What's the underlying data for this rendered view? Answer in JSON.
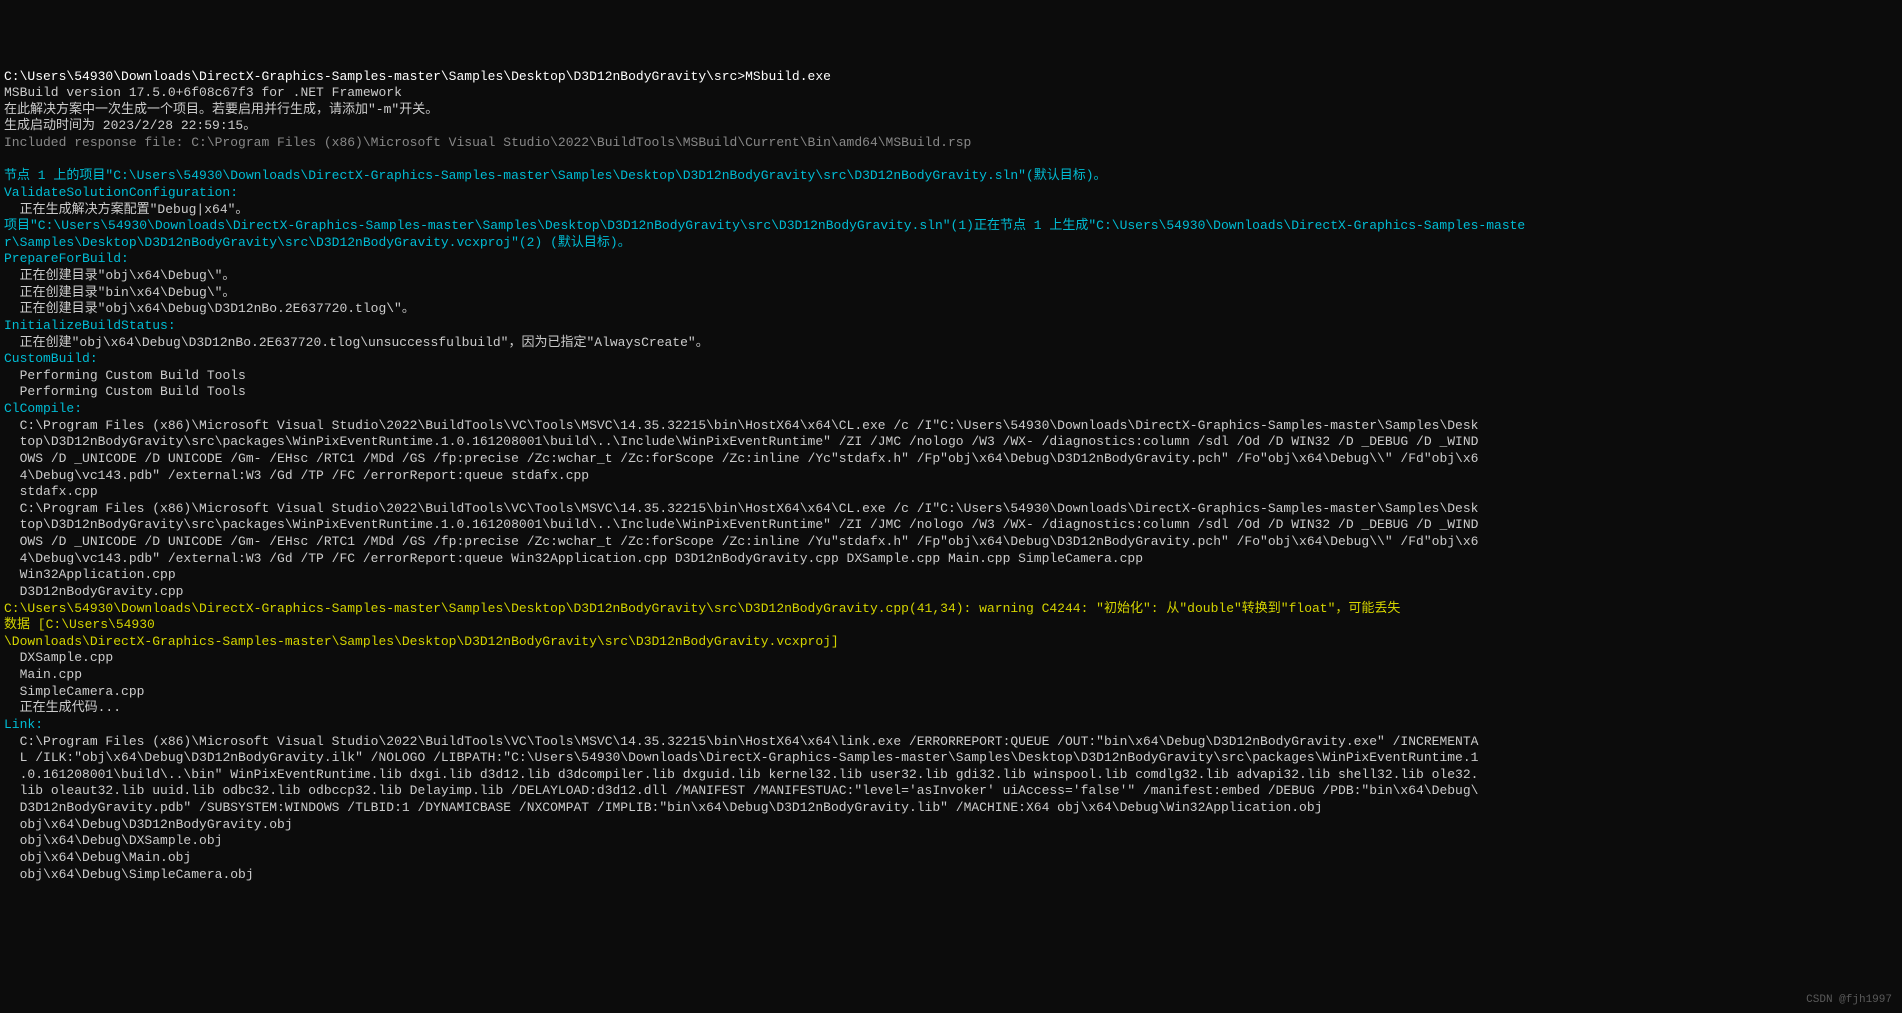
{
  "lines": [
    {
      "cls": "white",
      "t": "C:\\Users\\54930\\Downloads\\DirectX-Graphics-Samples-master\\Samples\\Desktop\\D3D12nBodyGravity\\src>MSbuild.exe"
    },
    {
      "cls": "gray",
      "t": "MSBuild version 17.5.0+6f08c67f3 for .NET Framework"
    },
    {
      "cls": "gray",
      "t": "在此解决方案中一次生成一个项目。若要启用并行生成，请添加\"-m\"开关。"
    },
    {
      "cls": "gray",
      "t": "生成启动时间为 2023/2/28 22:59:15。"
    },
    {
      "cls": "dim",
      "t": "Included response file: C:\\Program Files (x86)\\Microsoft Visual Studio\\2022\\BuildTools\\MSBuild\\Current\\Bin\\amd64\\MSBuild.rsp"
    },
    {
      "cls": "gray",
      "t": ""
    },
    {
      "cls": "cyan",
      "t": "节点 1 上的项目\"C:\\Users\\54930\\Downloads\\DirectX-Graphics-Samples-master\\Samples\\Desktop\\D3D12nBodyGravity\\src\\D3D12nBodyGravity.sln\"(默认目标)。"
    },
    {
      "cls": "cyan",
      "t": "ValidateSolutionConfiguration:"
    },
    {
      "cls": "gray",
      "t": "  正在生成解决方案配置\"Debug|x64\"。"
    },
    {
      "cls": "cyan",
      "t": "项目\"C:\\Users\\54930\\Downloads\\DirectX-Graphics-Samples-master\\Samples\\Desktop\\D3D12nBodyGravity\\src\\D3D12nBodyGravity.sln\"(1)正在节点 1 上生成\"C:\\Users\\54930\\Downloads\\DirectX-Graphics-Samples-maste"
    },
    {
      "cls": "cyan",
      "t": "r\\Samples\\Desktop\\D3D12nBodyGravity\\src\\D3D12nBodyGravity.vcxproj\"(2) (默认目标)。"
    },
    {
      "cls": "cyan",
      "t": "PrepareForBuild:"
    },
    {
      "cls": "gray",
      "t": "  正在创建目录\"obj\\x64\\Debug\\\"。"
    },
    {
      "cls": "gray",
      "t": "  正在创建目录\"bin\\x64\\Debug\\\"。"
    },
    {
      "cls": "gray",
      "t": "  正在创建目录\"obj\\x64\\Debug\\D3D12nBo.2E637720.tlog\\\"。"
    },
    {
      "cls": "cyan",
      "t": "InitializeBuildStatus:"
    },
    {
      "cls": "gray",
      "t": "  正在创建\"obj\\x64\\Debug\\D3D12nBo.2E637720.tlog\\unsuccessfulbuild\"，因为已指定\"AlwaysCreate\"。"
    },
    {
      "cls": "cyan",
      "t": "CustomBuild:"
    },
    {
      "cls": "gray",
      "t": "  Performing Custom Build Tools"
    },
    {
      "cls": "gray",
      "t": "  Performing Custom Build Tools"
    },
    {
      "cls": "cyan",
      "t": "ClCompile:"
    },
    {
      "cls": "gray",
      "t": "  C:\\Program Files (x86)\\Microsoft Visual Studio\\2022\\BuildTools\\VC\\Tools\\MSVC\\14.35.32215\\bin\\HostX64\\x64\\CL.exe /c /I\"C:\\Users\\54930\\Downloads\\DirectX-Graphics-Samples-master\\Samples\\Desk"
    },
    {
      "cls": "gray",
      "t": "  top\\D3D12nBodyGravity\\src\\packages\\WinPixEventRuntime.1.0.161208001\\build\\..\\Include\\WinPixEventRuntime\" /ZI /JMC /nologo /W3 /WX- /diagnostics:column /sdl /Od /D WIN32 /D _DEBUG /D _WIND"
    },
    {
      "cls": "gray",
      "t": "  OWS /D _UNICODE /D UNICODE /Gm- /EHsc /RTC1 /MDd /GS /fp:precise /Zc:wchar_t /Zc:forScope /Zc:inline /Yc\"stdafx.h\" /Fp\"obj\\x64\\Debug\\D3D12nBodyGravity.pch\" /Fo\"obj\\x64\\Debug\\\\\" /Fd\"obj\\x6"
    },
    {
      "cls": "gray",
      "t": "  4\\Debug\\vc143.pdb\" /external:W3 /Gd /TP /FC /errorReport:queue stdafx.cpp"
    },
    {
      "cls": "gray",
      "t": "  stdafx.cpp"
    },
    {
      "cls": "gray",
      "t": "  C:\\Program Files (x86)\\Microsoft Visual Studio\\2022\\BuildTools\\VC\\Tools\\MSVC\\14.35.32215\\bin\\HostX64\\x64\\CL.exe /c /I\"C:\\Users\\54930\\Downloads\\DirectX-Graphics-Samples-master\\Samples\\Desk"
    },
    {
      "cls": "gray",
      "t": "  top\\D3D12nBodyGravity\\src\\packages\\WinPixEventRuntime.1.0.161208001\\build\\..\\Include\\WinPixEventRuntime\" /ZI /JMC /nologo /W3 /WX- /diagnostics:column /sdl /Od /D WIN32 /D _DEBUG /D _WIND"
    },
    {
      "cls": "gray",
      "t": "  OWS /D _UNICODE /D UNICODE /Gm- /EHsc /RTC1 /MDd /GS /fp:precise /Zc:wchar_t /Zc:forScope /Zc:inline /Yu\"stdafx.h\" /Fp\"obj\\x64\\Debug\\D3D12nBodyGravity.pch\" /Fo\"obj\\x64\\Debug\\\\\" /Fd\"obj\\x6"
    },
    {
      "cls": "gray",
      "t": "  4\\Debug\\vc143.pdb\" /external:W3 /Gd /TP /FC /errorReport:queue Win32Application.cpp D3D12nBodyGravity.cpp DXSample.cpp Main.cpp SimpleCamera.cpp"
    },
    {
      "cls": "gray",
      "t": "  Win32Application.cpp"
    },
    {
      "cls": "gray",
      "t": "  D3D12nBodyGravity.cpp"
    },
    {
      "cls": "yellow",
      "t": "C:\\Users\\54930\\Downloads\\DirectX-Graphics-Samples-master\\Samples\\Desktop\\D3D12nBodyGravity\\src\\D3D12nBodyGravity.cpp(41,34): warning C4244: \"初始化\": 从\"double\"转换到\"float\"，可能丢失"
    },
    {
      "cls": "yellow",
      "t": "数据 [C:\\Users\\54930"
    },
    {
      "cls": "yellow",
      "t": "\\Downloads\\DirectX-Graphics-Samples-master\\Samples\\Desktop\\D3D12nBodyGravity\\src\\D3D12nBodyGravity.vcxproj]"
    },
    {
      "cls": "gray",
      "t": "  DXSample.cpp"
    },
    {
      "cls": "gray",
      "t": "  Main.cpp"
    },
    {
      "cls": "gray",
      "t": "  SimpleCamera.cpp"
    },
    {
      "cls": "gray",
      "t": "  正在生成代码..."
    },
    {
      "cls": "cyan",
      "t": "Link:"
    },
    {
      "cls": "gray",
      "t": "  C:\\Program Files (x86)\\Microsoft Visual Studio\\2022\\BuildTools\\VC\\Tools\\MSVC\\14.35.32215\\bin\\HostX64\\x64\\link.exe /ERRORREPORT:QUEUE /OUT:\"bin\\x64\\Debug\\D3D12nBodyGravity.exe\" /INCREMENTA"
    },
    {
      "cls": "gray",
      "t": "  L /ILK:\"obj\\x64\\Debug\\D3D12nBodyGravity.ilk\" /NOLOGO /LIBPATH:\"C:\\Users\\54930\\Downloads\\DirectX-Graphics-Samples-master\\Samples\\Desktop\\D3D12nBodyGravity\\src\\packages\\WinPixEventRuntime.1"
    },
    {
      "cls": "gray",
      "t": "  .0.161208001\\build\\..\\bin\" WinPixEventRuntime.lib dxgi.lib d3d12.lib d3dcompiler.lib dxguid.lib kernel32.lib user32.lib gdi32.lib winspool.lib comdlg32.lib advapi32.lib shell32.lib ole32."
    },
    {
      "cls": "gray",
      "t": "  lib oleaut32.lib uuid.lib odbc32.lib odbccp32.lib Delayimp.lib /DELAYLOAD:d3d12.dll /MANIFEST /MANIFESTUAC:\"level='asInvoker' uiAccess='false'\" /manifest:embed /DEBUG /PDB:\"bin\\x64\\Debug\\"
    },
    {
      "cls": "gray",
      "t": "  D3D12nBodyGravity.pdb\" /SUBSYSTEM:WINDOWS /TLBID:1 /DYNAMICBASE /NXCOMPAT /IMPLIB:\"bin\\x64\\Debug\\D3D12nBodyGravity.lib\" /MACHINE:X64 obj\\x64\\Debug\\Win32Application.obj"
    },
    {
      "cls": "gray",
      "t": "  obj\\x64\\Debug\\D3D12nBodyGravity.obj"
    },
    {
      "cls": "gray",
      "t": "  obj\\x64\\Debug\\DXSample.obj"
    },
    {
      "cls": "gray",
      "t": "  obj\\x64\\Debug\\Main.obj"
    },
    {
      "cls": "gray",
      "t": "  obj\\x64\\Debug\\SimpleCamera.obj"
    }
  ],
  "watermark": "CSDN @fjh1997"
}
